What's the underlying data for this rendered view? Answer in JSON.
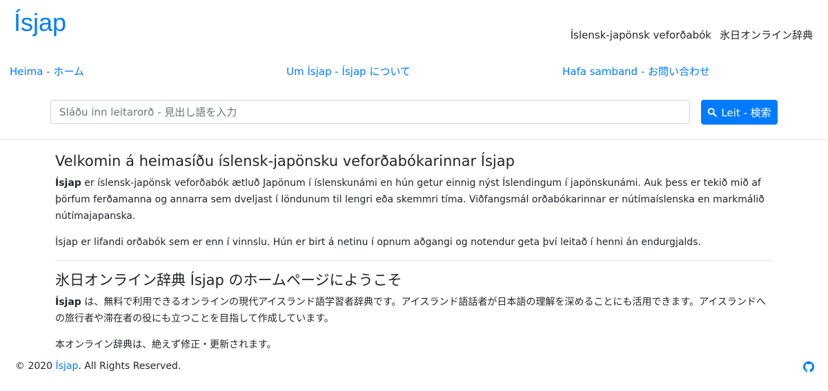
{
  "header": {
    "logo": "Ísjap",
    "tagline_is": "Íslensk-japönsk veforðabók",
    "tagline_ja": "氷日オンライン辞典"
  },
  "nav": {
    "home": "Heima - ホーム",
    "about": "Um Ísjap - Ísjap について",
    "contact": "Hafa samband - お問い合わせ"
  },
  "search": {
    "placeholder": "Sláðu inn leitarorð - 見出し語を入力",
    "value": "",
    "button_label": "Leit - 検索"
  },
  "main": {
    "is_section": {
      "heading": "Velkomin á heimasíðu íslensk-japönsku veforðabókarinnar Ísjap",
      "brand": "Ísjap",
      "para1": " er íslensk-japönsk veforðabók ætluð Japönum í íslenskunámi en hún getur einnig nýst Íslendingum í japönskunámi. Auk þess er tekið mið af þörfum ferðamanna og annarra sem dveljast í löndunum til lengri eða skemmri tíma. Viðfangsmál orðabókarinnar er nútímaíslenska en markmálið nútímajapanska.",
      "para2": "Ísjap er lifandi orðabók sem er enn í vinnslu. Hún er birt á netinu í opnum aðgangi og notendur geta því leitað í henni án endurgjalds."
    },
    "ja_section": {
      "heading": "氷日オンライン辞典 Ísjap のホームページにようこそ",
      "brand": "Ísjap",
      "para1": " は、無料で利用できるオンラインの現代アイスランド語学習者辞典です。アイスランド語話者が日本語の理解を深めることにも活用できます。アイスランドへの旅行者や滞在者の役にも立つことを目指して作成しています。",
      "para2": "本オンライン辞典は、絶えず修正・更新されます。"
    }
  },
  "footer": {
    "copyright_prefix": "© 2020 ",
    "brand_link": "Ísjap",
    "copyright_suffix": ". All Rights Reserved.",
    "icon": "github-icon"
  },
  "colors": {
    "accent": "#007bff",
    "text": "#212529",
    "divider": "#e5e5e5"
  }
}
